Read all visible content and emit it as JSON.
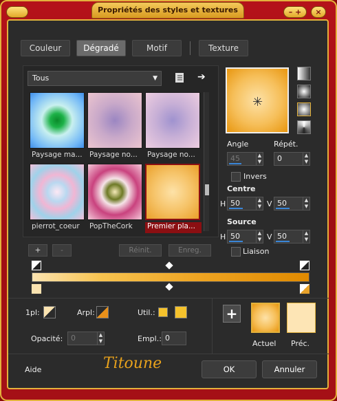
{
  "window": {
    "title": "Propriétés des styles et textures"
  },
  "tabs": [
    {
      "label": "Couleur"
    },
    {
      "label": "Dégradé"
    },
    {
      "label": "Motif"
    },
    {
      "label": "Texture"
    }
  ],
  "gallery": {
    "category": "Tous",
    "items": [
      {
        "label": "Paysage ma..."
      },
      {
        "label": "Paysage no..."
      },
      {
        "label": "Paysage no..."
      },
      {
        "label": "pierrot_coeur"
      },
      {
        "label": "PopTheCork"
      },
      {
        "label": "Premier pla..."
      }
    ],
    "add_label": "+",
    "remove_label": "-",
    "reset_label": "Réinit.",
    "save_label": "Enreg."
  },
  "controls": {
    "angle_label": "Angle",
    "angle_value": "45",
    "repeat_label": "Répét.",
    "repeat_value": "0",
    "invert_label": "Invers",
    "center_label": "Centre",
    "center_h_label": "H",
    "center_h": "50",
    "center_v_label": "V",
    "center_v": "50",
    "source_label": "Source",
    "source_h_label": "H",
    "source_h": "50",
    "source_v_label": "V",
    "source_v": "50",
    "link_label": "Liaison"
  },
  "bottom": {
    "ipl_label": "1pl:",
    "arpl_label": "Arpl:",
    "util_label": "Util.:",
    "opacity_label": "Opacité:",
    "opacity_value": "0",
    "empl_label": "Empl.:",
    "empl_value": "0",
    "current_label": "Actuel",
    "previous_label": "Préc.",
    "plus_label": "+"
  },
  "footer": {
    "help_label": "Aide",
    "signature": "Titoune",
    "ok_label": "OK",
    "cancel_label": "Annuler"
  },
  "colors": {
    "gradient_start": "#fbe3b0",
    "gradient_end": "#e89a18",
    "accent_red": "#8b0f12",
    "gold": "#e3b23c"
  }
}
